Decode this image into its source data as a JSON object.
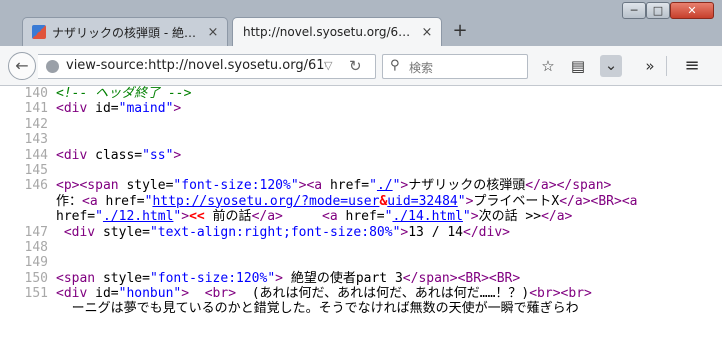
{
  "tabs": [
    {
      "title": "ナザリックの核弾頭 - 絶…",
      "close": "×"
    },
    {
      "title": "http://novel.syosetu.org/6…",
      "close": "×"
    }
  ],
  "new_tab_glyph": "+",
  "window": {
    "min": "─",
    "max": "□",
    "close": "✕"
  },
  "nav": {
    "url": "view-source:http://novel.syosetu.org/61(",
    "search_placeholder": "検索"
  },
  "source_lines": [
    {
      "num": "140",
      "parts": [
        [
          "cmt",
          "<!-- ヘッダ終了 -->"
        ]
      ]
    },
    {
      "num": "141",
      "parts": [
        [
          "tag",
          "<div "
        ],
        [
          "attr",
          "id="
        ],
        [
          "val",
          "\"maind\""
        ],
        [
          "tag",
          ">"
        ]
      ]
    },
    {
      "num": "142",
      "parts": []
    },
    {
      "num": "143",
      "parts": []
    },
    {
      "num": "144",
      "parts": [
        [
          "tag",
          "<div "
        ],
        [
          "attr",
          "class="
        ],
        [
          "val",
          "\"ss\""
        ],
        [
          "tag",
          ">"
        ]
      ]
    },
    {
      "num": "145",
      "parts": []
    },
    {
      "num": "146",
      "parts": [
        [
          "tag",
          "<p><span "
        ],
        [
          "attr",
          "style="
        ],
        [
          "val",
          "\"font-size:120%\""
        ],
        [
          "tag",
          "><a "
        ],
        [
          "attr",
          "href="
        ],
        [
          "val",
          "\""
        ],
        [
          "link",
          "./"
        ],
        [
          "val",
          "\""
        ],
        [
          "tag",
          ">"
        ],
        [
          "txt",
          "ナザリックの核弾頭"
        ],
        [
          "tag",
          "</a></span>"
        ]
      ]
    },
    {
      "num": "",
      "parts": [
        [
          "txt",
          "作："
        ],
        [
          "tag",
          "<a "
        ],
        [
          "attr",
          "href="
        ],
        [
          "val",
          "\""
        ],
        [
          "link",
          "http://syosetu.org/?mode=user"
        ],
        [
          "ent",
          "&"
        ],
        [
          "link",
          "uid=32484"
        ],
        [
          "val",
          "\""
        ],
        [
          "tag",
          ">"
        ],
        [
          "txt",
          "プライベートX"
        ],
        [
          "tag",
          "</a><BR><a"
        ]
      ]
    },
    {
      "num": "",
      "parts": [
        [
          "attr",
          "href="
        ],
        [
          "val",
          "\""
        ],
        [
          "link",
          "./12.html"
        ],
        [
          "val",
          "\""
        ],
        [
          "tag",
          ">"
        ],
        [
          "ent",
          "<<"
        ],
        [
          "txt",
          " 前の話"
        ],
        [
          "tag",
          "</a>"
        ],
        [
          "txt",
          "     "
        ],
        [
          "tag",
          "<a "
        ],
        [
          "attr",
          "href="
        ],
        [
          "val",
          "\""
        ],
        [
          "link",
          "./14.html"
        ],
        [
          "val",
          "\""
        ],
        [
          "tag",
          ">"
        ],
        [
          "txt",
          "次の話 >>"
        ],
        [
          "tag",
          "</a>"
        ]
      ]
    },
    {
      "num": "147",
      "parts": [
        [
          "txt",
          " "
        ],
        [
          "tag",
          "<div "
        ],
        [
          "attr",
          "style="
        ],
        [
          "val",
          "\"text-align:right;font-size:80%\""
        ],
        [
          "tag",
          ">"
        ],
        [
          "txt",
          "13 / 14"
        ],
        [
          "tag",
          "</div>"
        ]
      ]
    },
    {
      "num": "148",
      "parts": []
    },
    {
      "num": "149",
      "parts": []
    },
    {
      "num": "150",
      "parts": [
        [
          "tag",
          "<span "
        ],
        [
          "attr",
          "style="
        ],
        [
          "val",
          "\"font-size:120%\""
        ],
        [
          "tag",
          ">"
        ],
        [
          "txt",
          " 絶望の使者part 3"
        ],
        [
          "tag",
          "</span><BR><BR>"
        ]
      ]
    },
    {
      "num": "151",
      "parts": [
        [
          "tag",
          "<div "
        ],
        [
          "attr",
          "id="
        ],
        [
          "val",
          "\"honbun\""
        ],
        [
          "tag",
          ">"
        ],
        [
          "txt",
          "  "
        ],
        [
          "tag",
          "<br>"
        ],
        [
          "txt",
          "  (あれは何だ、あれは何だ、あれは何だ……！？)"
        ],
        [
          "tag",
          "<br><br>"
        ]
      ]
    },
    {
      "num": "",
      "parts": [
        [
          "txt",
          "  ーニグは夢でも見ているのかと錯覚した。そうでなければ無数の天使が一瞬で薙ぎらわ"
        ]
      ]
    }
  ]
}
